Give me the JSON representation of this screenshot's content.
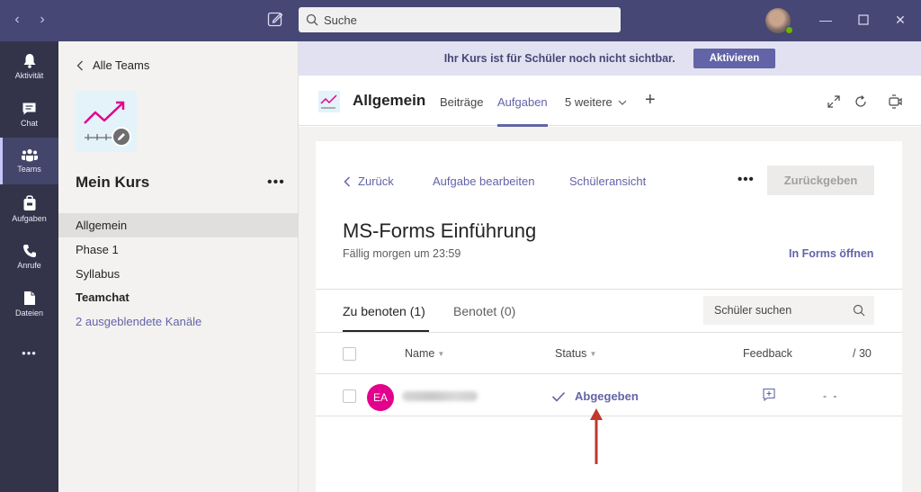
{
  "titlebar": {
    "search_placeholder": "Suche"
  },
  "rail": {
    "items": [
      {
        "label": "Aktivität",
        "icon": "bell-icon"
      },
      {
        "label": "Chat",
        "icon": "chat-icon"
      },
      {
        "label": "Teams",
        "icon": "teams-icon",
        "active": true
      },
      {
        "label": "Aufgaben",
        "icon": "assignments-icon"
      },
      {
        "label": "Anrufe",
        "icon": "phone-icon"
      },
      {
        "label": "Dateien",
        "icon": "file-icon"
      }
    ],
    "more": "•••"
  },
  "teampanel": {
    "back_label": "Alle Teams",
    "team_name": "Mein Kurs",
    "more": "•••",
    "channels": [
      "Allgemein",
      "Phase 1",
      "Syllabus",
      "Teamchat"
    ],
    "hidden_channels": "2 ausgeblendete Kanäle"
  },
  "banner": {
    "text": "Ihr Kurs ist für Schüler noch nicht sichtbar.",
    "button": "Aktivieren"
  },
  "channel_header": {
    "title": "Allgemein",
    "tabs": [
      "Beiträge",
      "Aufgaben",
      "5 weitere"
    ],
    "active_tab": "Aufgaben"
  },
  "assignment": {
    "back": "Zurück",
    "edit": "Aufgabe bearbeiten",
    "student_view": "Schüleransicht",
    "more": "•••",
    "return_button": "Zurückgeben",
    "title": "MS-Forms Einführung",
    "due": "Fällig morgen um 23:59",
    "open_forms": "In Forms öffnen",
    "tabs": {
      "to_grade": "Zu benoten (1)",
      "graded": "Benotet (0)"
    },
    "student_search_placeholder": "Schüler suchen",
    "columns": {
      "name": "Name",
      "status": "Status",
      "feedback": "Feedback",
      "points": "/ 30"
    },
    "rows": [
      {
        "initials": "EA",
        "status": "Abgegeben",
        "score": "- -"
      }
    ]
  },
  "colors": {
    "accent": "#6264a7",
    "titlebar": "#464775",
    "rail": "#33344a",
    "avatar": "#e3008c",
    "annotation_arrow": "#c0392b"
  }
}
